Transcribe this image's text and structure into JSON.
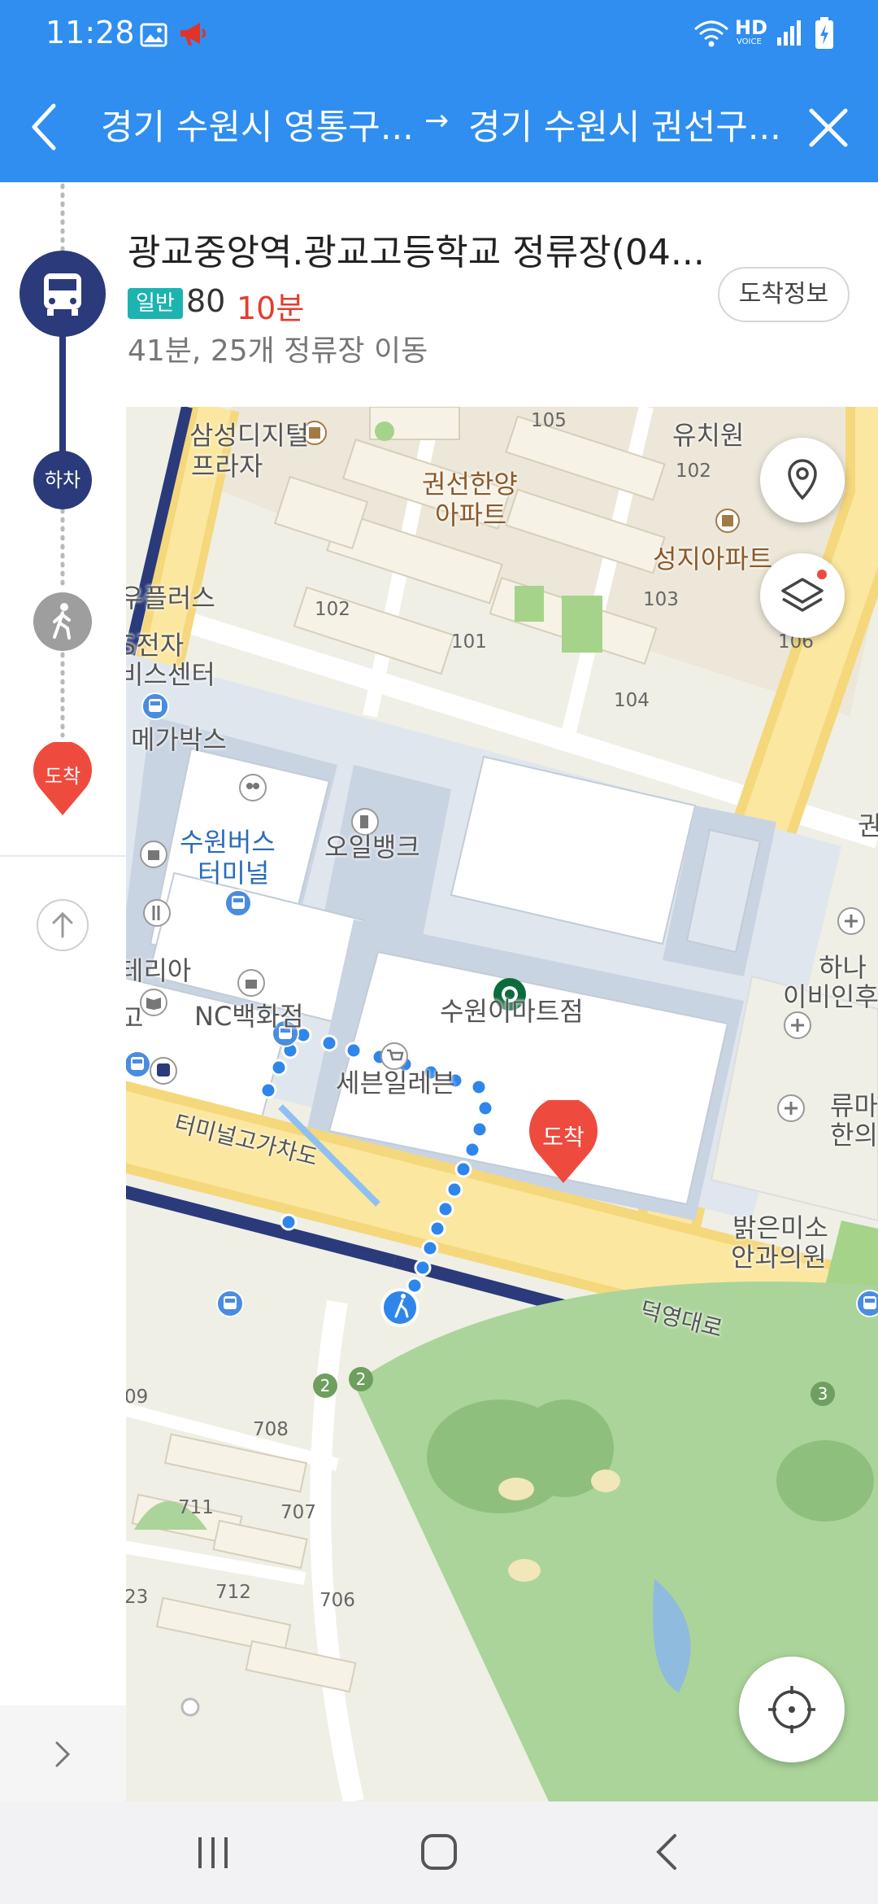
{
  "status_bar": {
    "time": "11:28",
    "left_icons": [
      "gallery-icon",
      "megaphone-icon"
    ],
    "right_icons": [
      "wifi-icon",
      "hd-voice-icon",
      "signal-icon",
      "battery-charging-icon"
    ],
    "hd_label": "HD",
    "voice_label": "VOICE"
  },
  "header": {
    "origin": "경기 수원시 영통구...",
    "arrow": "→",
    "destination": "경기 수원시 권선구..."
  },
  "info_panel": {
    "stop_name": "광교중앙역.광교고등학교 정류장(04...",
    "route_type": "일반",
    "route_number": "80",
    "route_minutes": "10분",
    "route_desc": "41분, 25개 정류장 이동",
    "arrive_info_button": "도착정보"
  },
  "sidebar": {
    "alight_label": "하차",
    "arrive_label": "도착"
  },
  "map": {
    "arrive_marker": "도착",
    "labels": {
      "samsung_digital": "삼성디지털",
      "plaza": "프라자",
      "gwonseon_hanyang": "권선한양",
      "apart": "아파트",
      "kindergarten": "유치원",
      "seongji_apt": "성지아파트",
      "plus": "우플러스",
      "electronics": "S전자",
      "service_center": "비스센터",
      "megabox": "메가박스",
      "suwon_bus": "수원버스",
      "terminal": "터미널",
      "oil_bank": "오일뱅크",
      "teria": "테리아",
      "nc_dept": "NC백화점",
      "emart": "수원이마트점",
      "seven_eleven": "세븐일레븐",
      "terminal_overpass": "터미널고가차도",
      "deogyeong_ro": "덕영대로",
      "hana": "하나",
      "ent": "이비인후",
      "ryuma": "류마",
      "korean_medicine": "한의",
      "bright_eye": "밝은미소",
      "eye_clinic": "안과의원",
      "go": "고",
      "gwon": "권"
    },
    "building_numbers": [
      "105",
      "102",
      "103",
      "106",
      "104",
      "102",
      "101",
      "708",
      "711",
      "707",
      "712",
      "706",
      "09",
      "23"
    ],
    "golf_numbers": [
      "2",
      "2",
      "3"
    ]
  },
  "colors": {
    "header_blue": "#2f8eef",
    "route_navy": "#2a3a7a",
    "arrive_red": "#ef4a3e",
    "walk_gray": "#9e9e9e",
    "route_type_teal": "#1cb3b0",
    "minutes_red": "#e53b2e",
    "walk_dot_blue": "#2f86ea"
  }
}
